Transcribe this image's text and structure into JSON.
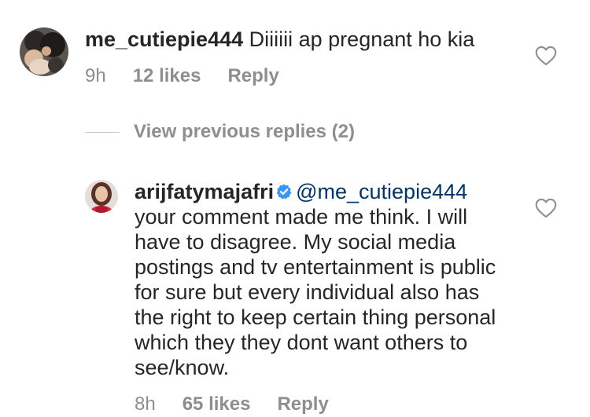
{
  "comment": {
    "username": "me_cutiepie444",
    "text": "Diiiiii ap pregnant ho kia",
    "time": "9h",
    "likes": "12 likes",
    "reply_label": "Reply"
  },
  "view_replies": {
    "label": "View previous replies (2)"
  },
  "reply": {
    "username": "arijfatymajafri",
    "mention": "@me_cutiepie444",
    "text": "your comment made me think. I will have to disagree. My social media postings and tv entertainment is public for sure but every individual also has the right to keep certain thing personal which they they dont want others to see/know.",
    "time": "8h",
    "likes": "65 likes",
    "reply_label": "Reply"
  },
  "colors": {
    "text": "#262626",
    "muted": "#8e8e8e",
    "mention": "#003569",
    "verified": "#3897f0"
  },
  "icons": {
    "like": "heart-outline-icon",
    "verified": "verified-badge-icon"
  }
}
